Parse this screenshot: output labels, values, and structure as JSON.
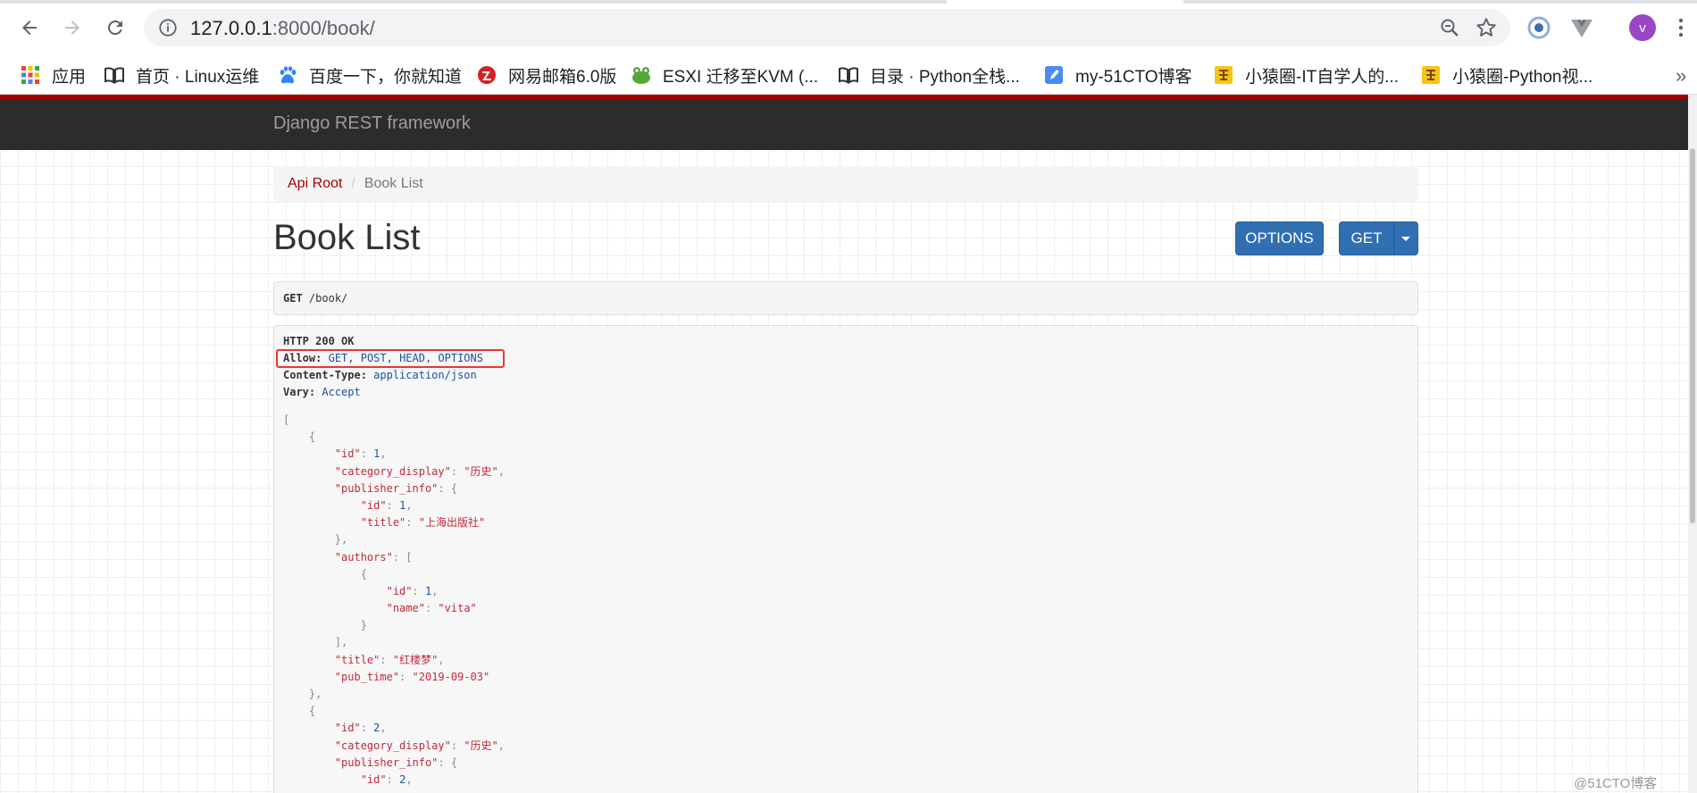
{
  "browser": {
    "url_host": "127.0.0.1",
    "url_path": ":8000/book/",
    "avatar_letter": "v",
    "bookmarks": [
      {
        "label": "应用",
        "icon": "apps-grid-icon"
      },
      {
        "label": "首页 · Linux运维",
        "icon": "book-icon"
      },
      {
        "label": "百度一下，你就知道",
        "icon": "baidu-paw-icon"
      },
      {
        "label": "网易邮箱6.0版",
        "icon": "netease-icon"
      },
      {
        "label": "ESXI 迁移至KVM (...",
        "icon": "frog-icon"
      },
      {
        "label": "目录 · Python全栈...",
        "icon": "book-icon"
      },
      {
        "label": "my-51CTO博客",
        "icon": "pen-icon"
      },
      {
        "label": "小猿圈-IT自学人的...",
        "icon": "yuan-icon"
      },
      {
        "label": "小猿圈-Python视...",
        "icon": "yuan-icon"
      }
    ],
    "more_bookmarks": "»"
  },
  "page": {
    "brand": "Django REST framework",
    "breadcrumb": {
      "root": "Api Root",
      "separator": "/",
      "current": "Book List"
    },
    "title": "Book List",
    "buttons": {
      "options": "OPTIONS",
      "get": "GET"
    },
    "request": {
      "method": "GET",
      "path": "/book/"
    },
    "response": {
      "status": "HTTP 200 OK",
      "headers": [
        {
          "name": "Allow:",
          "value": "GET, POST, HEAD, OPTIONS"
        },
        {
          "name": "Content-Type:",
          "value": "application/json"
        },
        {
          "name": "Vary:",
          "value": "Accept"
        }
      ],
      "body_lines": [
        "[",
        "    {",
        "        \"id\": 1,",
        "        \"category_display\": \"历史\",",
        "        \"publisher_info\": {",
        "            \"id\": 1,",
        "            \"title\": \"上海出版社\"",
        "        },",
        "        \"authors\": [",
        "            {",
        "                \"id\": 1,",
        "                \"name\": \"vita\"",
        "            }",
        "        ],",
        "        \"title\": \"红楼梦\",",
        "        \"pub_time\": \"2019-09-03\"",
        "    },",
        "    {",
        "        \"id\": 2,",
        "        \"category_display\": \"历史\",",
        "        \"publisher_info\": {",
        "            \"id\": 2,"
      ]
    }
  },
  "watermark": "@51CTO博客"
}
